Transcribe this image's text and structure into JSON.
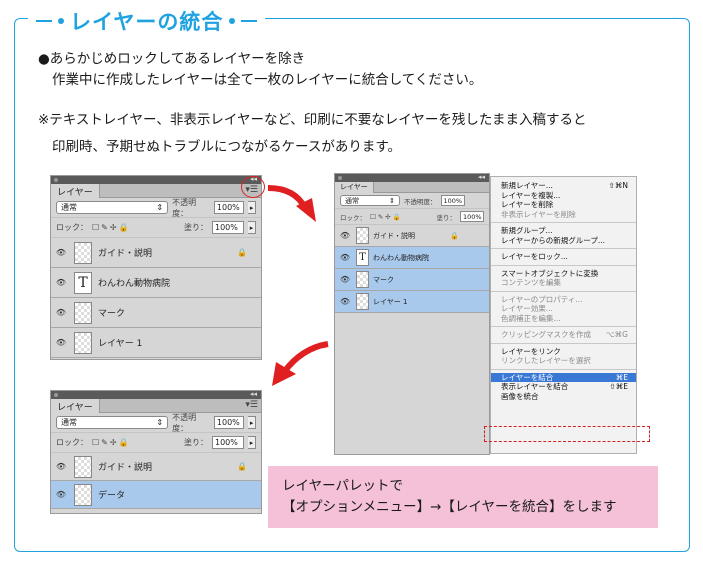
{
  "title": "レイヤーの統合",
  "bullet_line1": "●あらかじめロックしてあるレイヤーを除き",
  "bullet_line2": "作業中に作成したレイヤーは全て一枚のレイヤーに統合してください。",
  "note_line1": "※テキストレイヤー、非表示レイヤーなど、印刷に不要なレイヤーを残したまま入稿すると",
  "note_line2": "印刷時、予期せぬトラブルにつながるケースがあります。",
  "panel_before": {
    "tab": "レイヤー",
    "blend_mode": "通常",
    "opacity_label": "不透明度：",
    "opacity": "100%",
    "lock_label": "ロック：",
    "fill_label": "塗り：",
    "fill": "100%",
    "layers": [
      {
        "name": "ガイド・説明",
        "locked": true,
        "type": "image"
      },
      {
        "name": "わんわん動物病院",
        "type": "text"
      },
      {
        "name": "マーク",
        "type": "image"
      },
      {
        "name": "レイヤー 1",
        "type": "image"
      }
    ]
  },
  "panel_menu": {
    "tab": "レイヤー",
    "blend_mode": "通常",
    "opacity_label": "不透明度：",
    "opacity": "100%",
    "lock_label": "ロック：",
    "fill_label": "塗り：",
    "fill": "100%",
    "layers": [
      {
        "name": "ガイド・説明",
        "locked": true
      },
      {
        "name": "わんわん動物病院"
      },
      {
        "name": "マーク"
      },
      {
        "name": "レイヤー 1"
      }
    ]
  },
  "context_menu": [
    {
      "label": "新規レイヤー...",
      "shortcut": "⇧⌘N"
    },
    {
      "label": "レイヤーを複製..."
    },
    {
      "label": "レイヤーを削除"
    },
    {
      "label": "非表示レイヤーを削除",
      "disabled": true
    },
    {
      "sep": true
    },
    {
      "label": "新規グループ..."
    },
    {
      "label": "レイヤーからの新規グループ..."
    },
    {
      "sep": true
    },
    {
      "label": "レイヤーをロック..."
    },
    {
      "sep": true
    },
    {
      "label": "スマートオブジェクトに変換"
    },
    {
      "label": "コンテンツを編集",
      "disabled": true
    },
    {
      "sep": true
    },
    {
      "label": "レイヤーのプロパティ...",
      "disabled": true
    },
    {
      "label": "レイヤー効果...",
      "disabled": true
    },
    {
      "label": "色調補正を編集...",
      "disabled": true
    },
    {
      "sep": true
    },
    {
      "label": "クリッピングマスクを作成",
      "shortcut": "⌥⌘G",
      "disabled": true
    },
    {
      "sep": true
    },
    {
      "label": "レイヤーをリンク"
    },
    {
      "label": "リンクしたレイヤーを選択",
      "disabled": true
    },
    {
      "sep": true
    },
    {
      "label": "レイヤーを結合",
      "shortcut": "⌘E",
      "highlight": true
    },
    {
      "label": "表示レイヤーを結合",
      "shortcut": "⇧⌘E"
    },
    {
      "label": "画像を統合"
    }
  ],
  "panel_after": {
    "tab": "レイヤー",
    "blend_mode": "通常",
    "opacity_label": "不透明度：",
    "opacity": "100%",
    "lock_label": "ロック：",
    "fill_label": "塗り：",
    "fill": "100%",
    "layers": [
      {
        "name": "ガイド・説明",
        "locked": true
      },
      {
        "name": "データ"
      }
    ]
  },
  "callout_line1": "レイヤーパレットで",
  "callout_line2": "【オプションメニュー】→【レイヤーを統合】をします",
  "colors": {
    "accent": "#1fa3e0",
    "arrow": "#e02020",
    "callout_bg": "#f4c1d8",
    "selected_layer": "#a9c9ec"
  }
}
